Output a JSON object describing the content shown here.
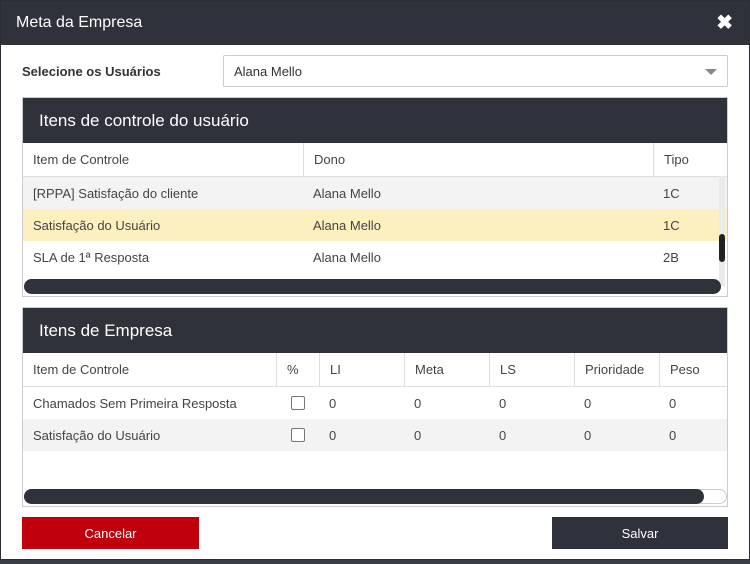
{
  "modal": {
    "title": "Meta da Empresa",
    "close_symbol": "✖"
  },
  "user_select": {
    "label": "Selecione os Usuários",
    "value": "Alana Mello"
  },
  "user_items": {
    "title": "Itens de controle do usuário",
    "columns": [
      "Item de Controle",
      "Dono",
      "Tipo"
    ],
    "rows": [
      {
        "item": "[RPPA] Satisfação do cliente",
        "owner": "Alana Mello",
        "type": "1C"
      },
      {
        "item": "Satisfação do Usuário",
        "owner": "Alana Mello",
        "type": "1C"
      },
      {
        "item": "SLA de 1ª Resposta",
        "owner": "Alana Mello",
        "type": "2B"
      }
    ]
  },
  "company_items": {
    "title": "Itens de Empresa",
    "columns": [
      "Item de Controle",
      "%",
      "LI",
      "Meta",
      "LS",
      "Prioridade",
      "Peso"
    ],
    "rows": [
      {
        "item": "Chamados Sem Primeira Resposta",
        "li": "0",
        "meta": "0",
        "ls": "0",
        "priority": "0",
        "weight": "0"
      },
      {
        "item": "Satisfação do Usuário",
        "li": "0",
        "meta": "0",
        "ls": "0",
        "priority": "0",
        "weight": "0"
      }
    ]
  },
  "buttons": {
    "cancel": "Cancelar",
    "save": "Salvar"
  },
  "colors": {
    "header_bg": "#2f323a",
    "cancel_bg": "#c0000c",
    "selected_row": "#fdf0c0"
  }
}
